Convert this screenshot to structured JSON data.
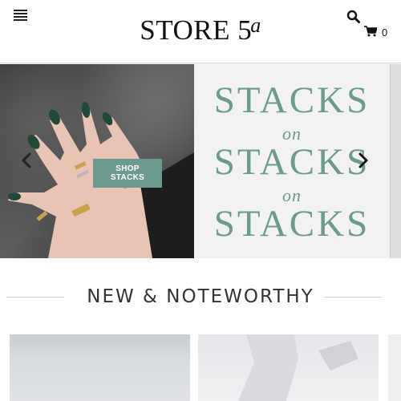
{
  "header": {
    "logo_text": "STORE 5",
    "logo_sup": "a",
    "cart_count": "0"
  },
  "hero": {
    "stacks_1": "STACKS",
    "on_1": "on",
    "stacks_2": "STACKS",
    "on_2": "on",
    "stacks_3": "STACKS",
    "button_label": "SHOP STACKS",
    "accent_color": "#6b9a8f"
  },
  "section": {
    "title": "NEW & NOTEWORTHY"
  },
  "icons": {
    "menu": "menu-icon",
    "search": "search-icon",
    "cart": "cart-icon",
    "prev": "chevron-left-icon",
    "next": "chevron-right-icon"
  }
}
